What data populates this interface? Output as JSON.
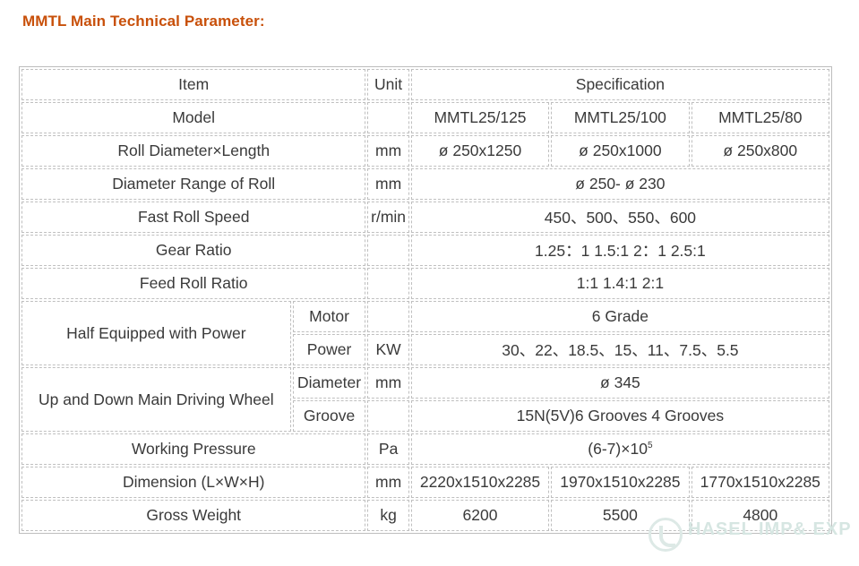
{
  "title": "MMTL Main Technical Parameter:",
  "colors": {
    "heading": "#c8500a",
    "text": "#3a3a3a",
    "border": "#bfbfbf"
  },
  "header": {
    "item": "Item",
    "unit": "Unit",
    "specification": "Specification"
  },
  "model": {
    "label": "Model",
    "values": [
      "MMTL25/125",
      "MMTL25/100",
      "MMTL25/80"
    ]
  },
  "roll_size": {
    "label": "Roll Diameter×Length",
    "unit": "mm",
    "values": [
      "ø 250x1250",
      "ø 250x1000",
      "ø 250x800"
    ]
  },
  "diameter_range": {
    "label": "Diameter Range of Roll",
    "unit": "mm",
    "value": "ø 250- ø 230"
  },
  "fast_speed": {
    "label": "Fast Roll Speed",
    "unit": "r/min",
    "value": "450、500、550、600"
  },
  "gear_ratio": {
    "label": "Gear Ratio",
    "unit": "",
    "value": "1.25：1 1.5:1 2：1 2.5:1"
  },
  "feed_ratio": {
    "label": "Feed Roll Ratio",
    "unit": "",
    "value": "1:1 1.4:1 2:1"
  },
  "half_power": {
    "label": "Half Equipped with Power",
    "motor": {
      "label": "Motor",
      "unit": "",
      "value": "6 Grade"
    },
    "power": {
      "label": "Power",
      "unit": "KW",
      "value": "30、22、18.5、15、11、7.5、5.5"
    }
  },
  "driving_wheel": {
    "label": "Up and Down Main Driving Wheel",
    "diameter": {
      "label": "Diameter",
      "unit": "mm",
      "value": "ø 345"
    },
    "groove": {
      "label": "Groove",
      "unit": "",
      "value": "15N(5V)6 Grooves 4 Grooves"
    }
  },
  "pressure": {
    "label": "Working Pressure",
    "unit": "Pa",
    "value_base": "(6-7)×10",
    "value_exp": "5"
  },
  "dimension": {
    "label": "Dimension (L×W×H)",
    "unit": "mm",
    "values": [
      "2220x1510x2285",
      "1970x1510x2285",
      "1770x1510x2285"
    ]
  },
  "weight": {
    "label": "Gross Weight",
    "unit": "kg",
    "values": [
      "6200",
      "5500",
      "4800"
    ]
  },
  "watermark": {
    "text": "HASEL IMP& EXP",
    "icon": "leaf-swirl-icon"
  }
}
